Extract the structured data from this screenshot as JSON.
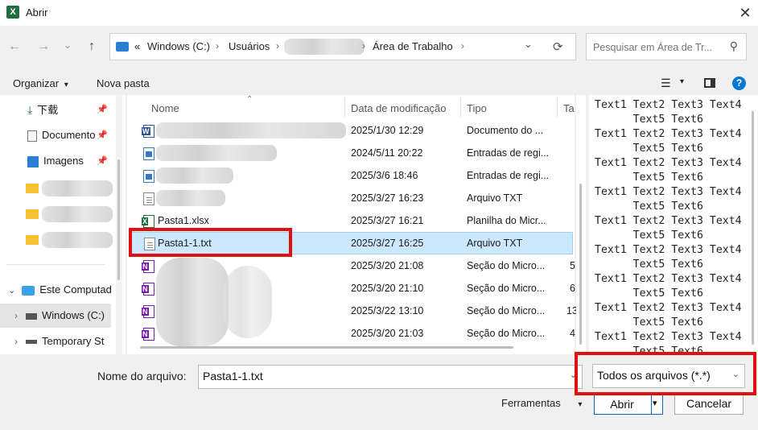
{
  "window": {
    "title": "Abrir",
    "app_icon_letter": "X",
    "close_glyph": "✕"
  },
  "nav": {
    "back_glyph": "←",
    "forward_glyph": "→",
    "recent_glyph": "⌄",
    "up_glyph": "↑"
  },
  "address": {
    "overflow": "«",
    "drive": "Windows (C:)",
    "sep": "›",
    "users": "Usuários",
    "folder": "Área de Trabalho",
    "dropdown_glyph": "⌄",
    "refresh_glyph": "⟳"
  },
  "search": {
    "placeholder": "Pesquisar em Área de Tr...",
    "icon_glyph": "⚲"
  },
  "toolbar": {
    "organize": "Organizar",
    "organize_caret": "▾",
    "new_folder": "Nova pasta",
    "view_glyph": "☰",
    "view_caret": "▾",
    "help_glyph": "?"
  },
  "sidebar": {
    "downloads": "下载",
    "documents": "Documento",
    "images": "Imagens",
    "pin_glyph": "📌",
    "this_pc": "Este Computad",
    "windows_c": "Windows (C:)",
    "temporary": "Temporary St",
    "expand_glyph": "›",
    "collapse_glyph": "⌄"
  },
  "columns": {
    "name": "Nome",
    "date": "Data de modificação",
    "type": "Tipo",
    "size": "Ta",
    "sort_glyph": "⌃"
  },
  "files": [
    {
      "name": "",
      "date": "2025/1/30 12:29",
      "type": "Documento do ...",
      "size": "",
      "icon": "word"
    },
    {
      "name": "",
      "date": "2024/5/11 20:22",
      "type": "Entradas de regi...",
      "size": "",
      "icon": "reg"
    },
    {
      "name": "",
      "date": "2025/3/6 18:46",
      "type": "Entradas de regi...",
      "size": "",
      "icon": "reg"
    },
    {
      "name": "",
      "date": "2025/3/27 16:23",
      "type": "Arquivo TXT",
      "size": "",
      "icon": "txt"
    },
    {
      "name": "Pasta1.xlsx",
      "date": "2025/3/27 16:21",
      "type": "Planilha do Micr...",
      "size": "",
      "icon": "excel"
    },
    {
      "name": "Pasta1-1.txt",
      "date": "2025/3/27 16:25",
      "type": "Arquivo TXT",
      "size": "",
      "icon": "txt",
      "selected": true
    },
    {
      "name": "",
      "date": "2025/3/20 21:08",
      "type": "Seção do Micro...",
      "size": "5",
      "icon": "one"
    },
    {
      "name": "",
      "date": "2025/3/20 21:10",
      "type": "Seção do Micro...",
      "size": "6",
      "icon": "one"
    },
    {
      "name": "",
      "date": "2025/3/22 13:10",
      "type": "Seção do Micro...",
      "size": "13",
      "icon": "one"
    },
    {
      "name": "",
      "date": "2025/3/20 21:03",
      "type": "Seção do Micro...",
      "size": "4",
      "icon": "one"
    }
  ],
  "preview": {
    "text": "Text1 Text2 Text3 Text4\n      Text5 Text6\nText1 Text2 Text3 Text4\n      Text5 Text6\nText1 Text2 Text3 Text4\n      Text5 Text6\nText1 Text2 Text3 Text4\n      Text5 Text6\nText1 Text2 Text3 Text4\n      Text5 Text6\nText1 Text2 Text3 Text4\n      Text5 Text6\nText1 Text2 Text3 Text4\n      Text5 Text6\nText1 Text2 Text3 Text4\n      Text5 Text6\nText1 Text2 Text3 Text4\n      Text5 Text6"
  },
  "footer": {
    "filename_label": "Nome do arquivo:",
    "filename_value": "Pasta1-1.txt",
    "filetype_value": "Todos os arquivos (*.*)",
    "tools": "Ferramentas",
    "tools_caret": "▾",
    "open": "Abrir",
    "open_caret": "▾",
    "cancel": "Cancelar",
    "combo_chevron": "⌄"
  },
  "colors": {
    "selection": "#cce8ff",
    "highlight_red": "#e01010",
    "help_blue": "#0078d4",
    "excel_green": "#1d6f42"
  }
}
